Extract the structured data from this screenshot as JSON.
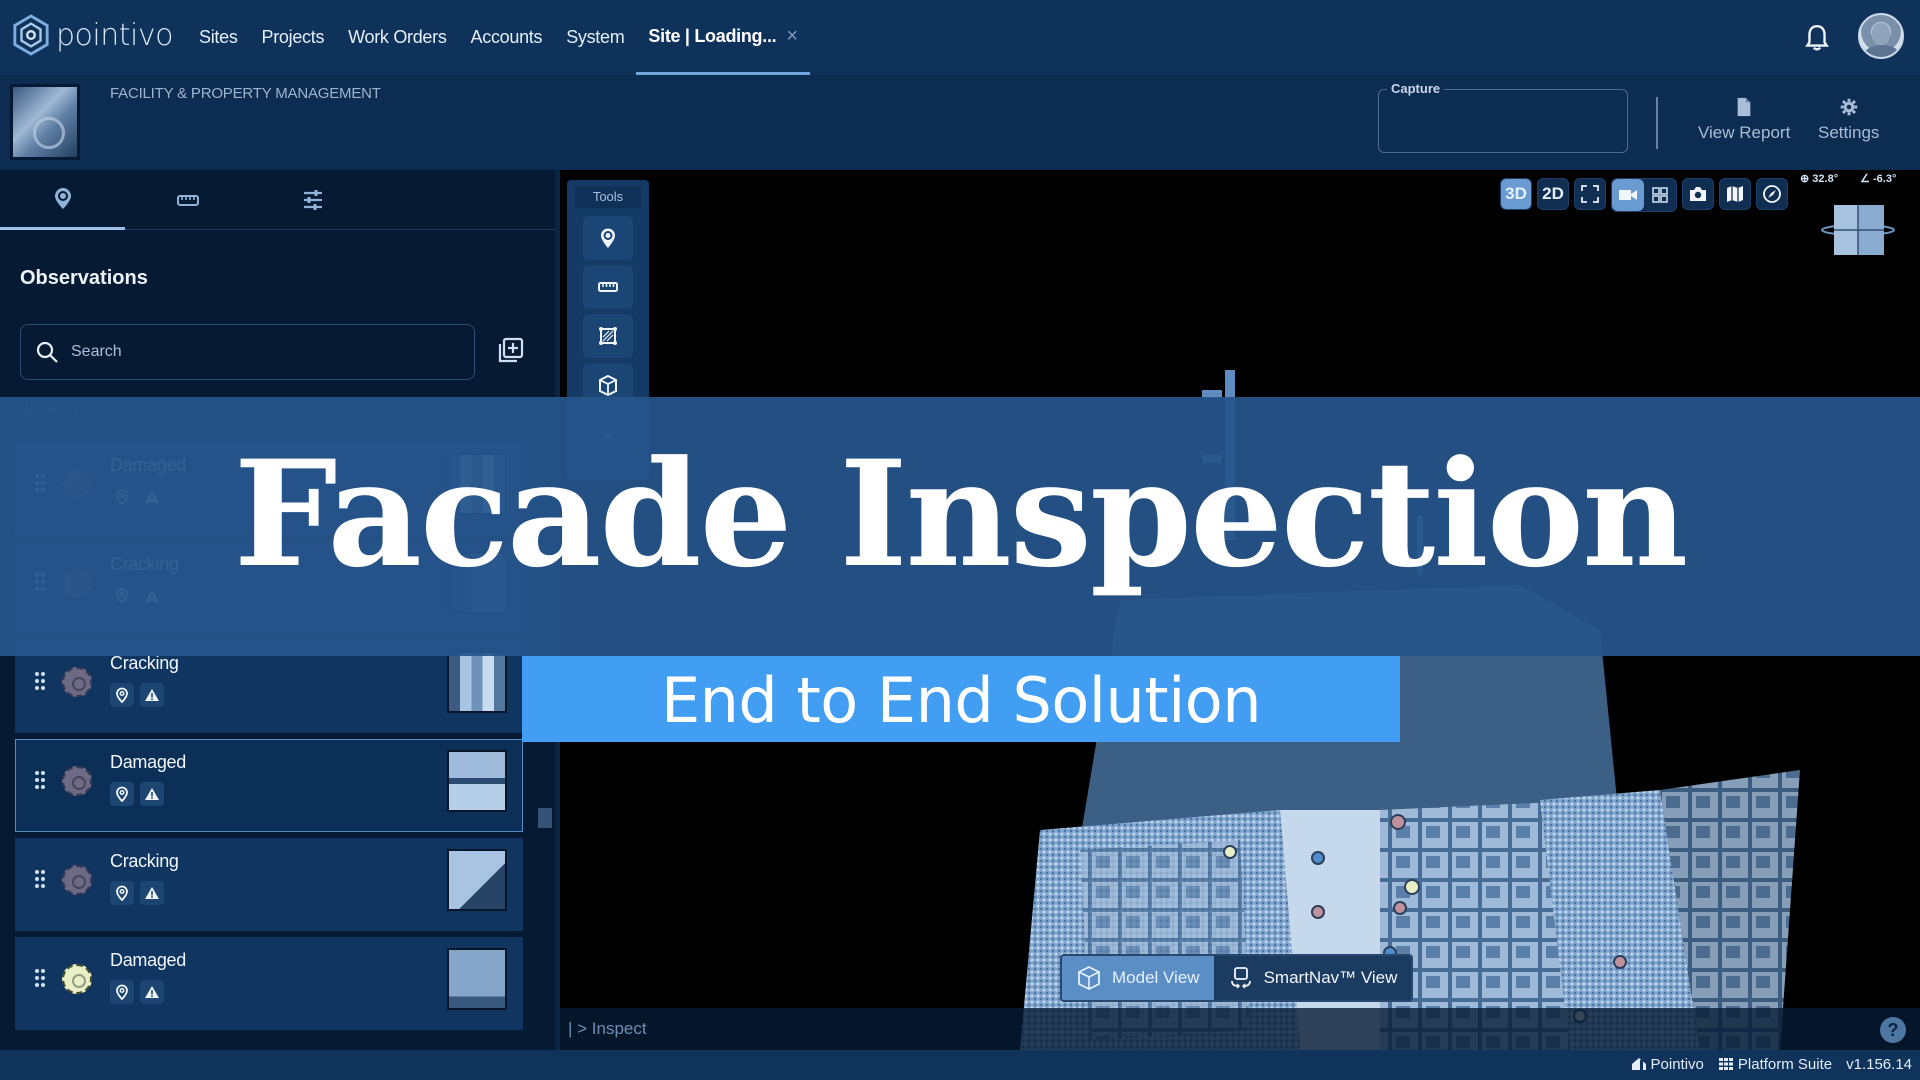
{
  "app": {
    "brand": "pointivo",
    "nav": [
      {
        "label": "Sites"
      },
      {
        "label": "Projects"
      },
      {
        "label": "Work Orders"
      },
      {
        "label": "Accounts"
      },
      {
        "label": "System"
      }
    ],
    "active_tab": {
      "label": "Site | Loading...",
      "close_icon": "×"
    }
  },
  "subheader": {
    "category": "FACILITY & PROPERTY MANAGEMENT",
    "capture_label": "Capture",
    "actions": [
      {
        "label": "View Report",
        "icon": "document-icon"
      },
      {
        "label": "Settings",
        "icon": "gear-icon"
      }
    ]
  },
  "left_panel": {
    "tabs": [
      {
        "icon": "location-pin-icon",
        "active": true
      },
      {
        "icon": "ruler-icon",
        "active": false
      },
      {
        "icon": "sliders-icon",
        "active": false
      }
    ],
    "title": "Observations",
    "search": {
      "placeholder": "Search",
      "value": ""
    },
    "results_text": "Showing 186 results",
    "observations": [
      {
        "name": "Damaged",
        "status_color": "#6d6a86",
        "selected": false
      },
      {
        "name": "Cracking",
        "status_color": "#6d6a86",
        "selected": false
      },
      {
        "name": "Cracking",
        "status_color": "#6d6a86",
        "selected": false
      },
      {
        "name": "Damaged",
        "status_color": "#6d6a86",
        "selected": true
      },
      {
        "name": "Cracking",
        "status_color": "#6d6a86",
        "selected": false
      },
      {
        "name": "Damaged",
        "status_color": "#e9efc6",
        "selected": false
      }
    ]
  },
  "viewer": {
    "tools_title": "Tools",
    "tools": [
      "observation-pin",
      "measure",
      "area",
      "volume",
      "navigate"
    ],
    "toolbar": {
      "btn_3d": "3D",
      "btn_2d": "2D",
      "active_mode": "3D"
    },
    "orientation": {
      "pitch": "32.8°",
      "angle": "-6.3°"
    },
    "view_switch": {
      "model_view": "Model View",
      "smartnav_view": "SmartNav™ View",
      "active": "Model View"
    },
    "console": "| > Inspect",
    "help": "?"
  },
  "footer": {
    "company": "Pointivo",
    "suite": "Platform Suite",
    "version": "v1.156.14"
  },
  "overlay": {
    "title": "Facade Inspection",
    "subtitle": "End to End Solution",
    "banner_color": "#26558c",
    "subtitle_color": "#429ef3"
  }
}
